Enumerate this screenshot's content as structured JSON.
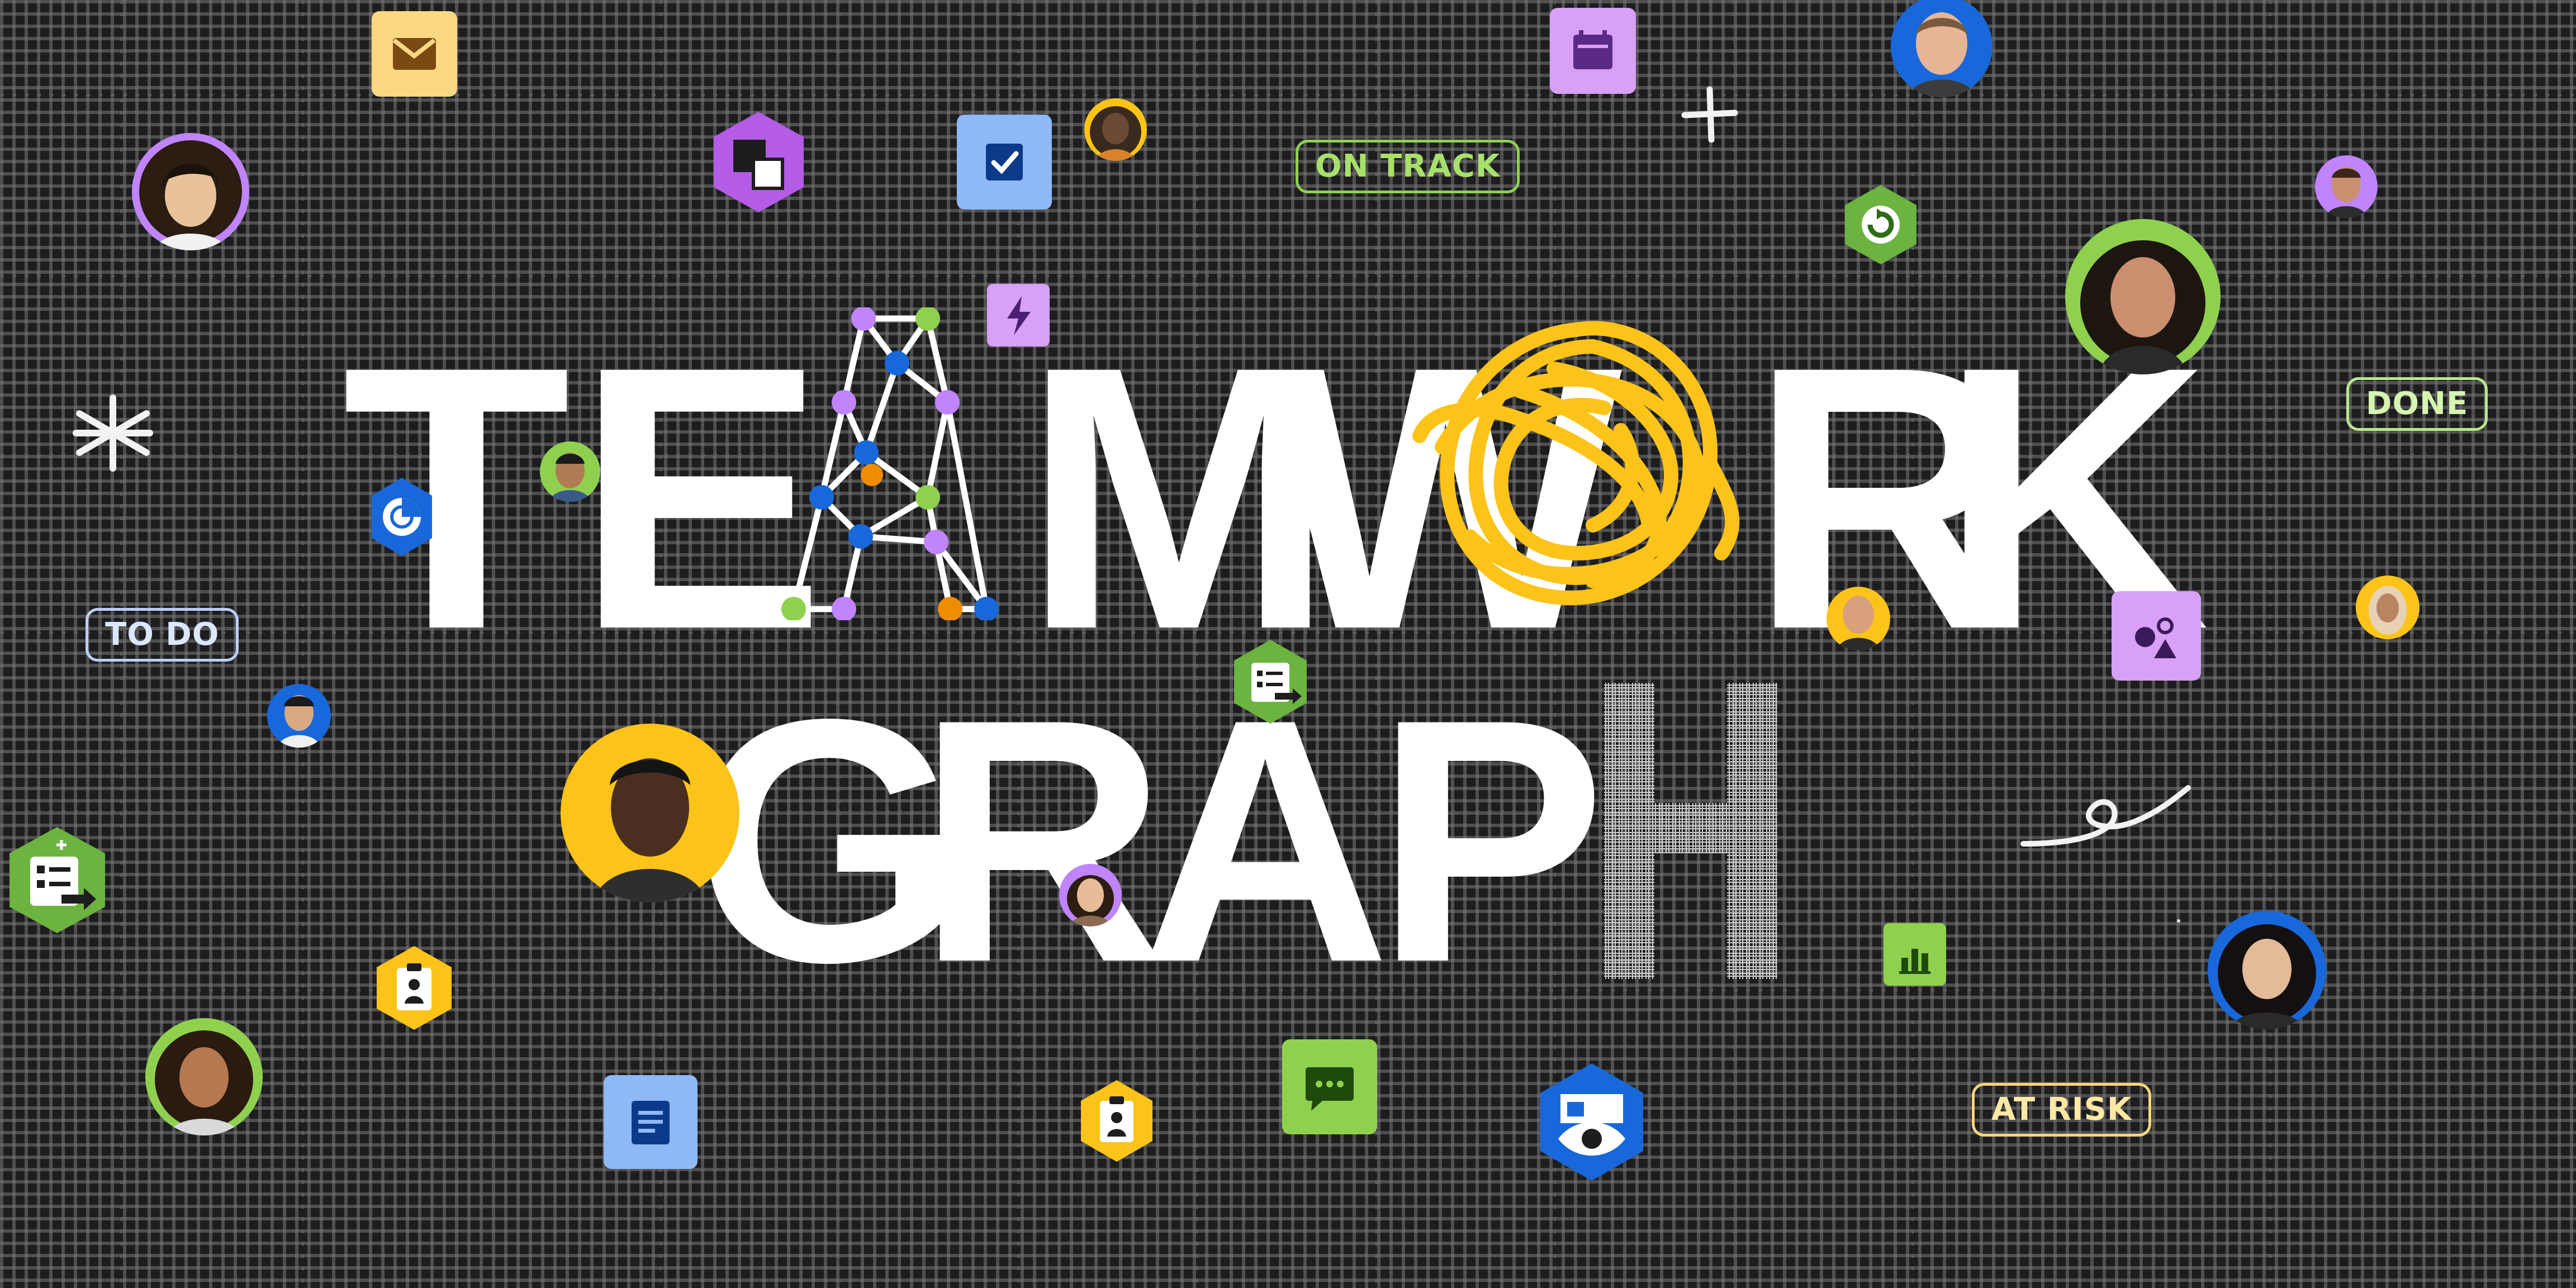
{
  "title": {
    "line1": [
      "T",
      "E",
      "",
      "M",
      "W",
      "",
      "R",
      "K"
    ],
    "line2": [
      "G",
      "R",
      "A",
      "P"
    ]
  },
  "labels": {
    "on_track": "ON TRACK",
    "done": "DONE",
    "to_do": "TO DO",
    "at_risk": "AT RISK"
  },
  "colors": {
    "background": "#1d1d1f",
    "text": "#ffffff",
    "green": "#8fd14f",
    "purple": "#c084fc",
    "blue": "#1868db",
    "yellow": "#fcc419",
    "light_blue": "#8fb8f6",
    "lilac": "#d8a0f7"
  }
}
